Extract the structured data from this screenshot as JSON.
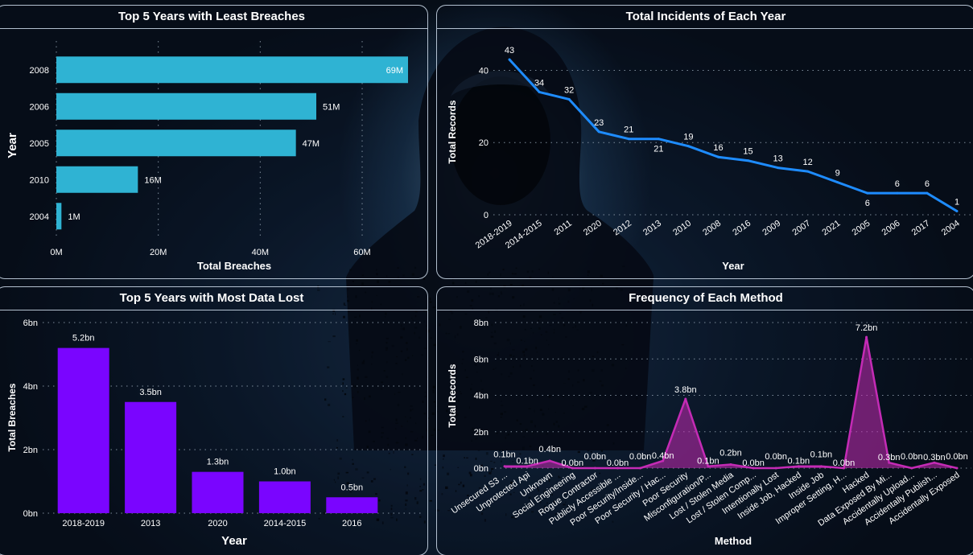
{
  "panels": {
    "least_breaches": {
      "title": "Top 5 Years with Least Breaches"
    },
    "incidents": {
      "title": "Total Incidents of Each Year"
    },
    "most_data_lost": {
      "title": "Top 5 Years with Most Data Lost"
    },
    "methods": {
      "title": "Frequency of Each Method"
    }
  },
  "colors": {
    "least_breaches_bar": "#2fb3d3",
    "incidents_line": "#1e8cff",
    "most_data_lost_bar": "#7a05ff",
    "methods_area": "#c42bb5"
  },
  "chart_data": [
    {
      "id": "least_breaches",
      "type": "bar",
      "orientation": "horizontal",
      "title": "Top 5 Years with Least Breaches",
      "xlabel": "Total Breaches",
      "ylabel": "Year",
      "categories": [
        "2008",
        "2006",
        "2005",
        "2010",
        "2004"
      ],
      "values": [
        69,
        51,
        47,
        16,
        1
      ],
      "value_labels": [
        "69M",
        "51M",
        "47M",
        "16M",
        "1M"
      ],
      "xlim": [
        0,
        69
      ],
      "x_ticks": [
        0,
        20,
        40,
        60
      ],
      "x_tick_labels": [
        "0M",
        "20M",
        "40M",
        "60M"
      ],
      "grid": true
    },
    {
      "id": "incidents",
      "type": "line",
      "title": "Total Incidents of Each Year",
      "xlabel": "Year",
      "ylabel": "Total Records",
      "categories": [
        "2018-2019",
        "2014-2015",
        "2011",
        "2020",
        "2012",
        "2013",
        "2010",
        "2008",
        "2016",
        "2009",
        "2007",
        "2021",
        "2005",
        "2006",
        "2017",
        "2004"
      ],
      "values": [
        43,
        34,
        32,
        23,
        21,
        21,
        19,
        16,
        15,
        13,
        12,
        9,
        6,
        6,
        6,
        1
      ],
      "value_labels": [
        "43",
        "34",
        "32",
        "23",
        "21",
        "21",
        "19",
        "16",
        "15",
        "13",
        "12",
        "9",
        "6",
        "6",
        "6",
        "1"
      ],
      "ylim": [
        0,
        45
      ],
      "y_ticks": [
        0,
        20,
        40
      ],
      "y_tick_labels": [
        "0",
        "20",
        "40"
      ],
      "grid": true
    },
    {
      "id": "most_data_lost",
      "type": "bar",
      "orientation": "vertical",
      "title": "Top 5 Years with Most Data Lost",
      "xlabel": "Year",
      "ylabel": "Total Breaches",
      "categories": [
        "2018-2019",
        "2013",
        "2020",
        "2014-2015",
        "2016"
      ],
      "values": [
        5.2,
        3.5,
        1.3,
        1.0,
        0.5
      ],
      "value_labels": [
        "5.2bn",
        "3.5bn",
        "1.3bn",
        "1.0bn",
        "0.5bn"
      ],
      "ylim": [
        0,
        6
      ],
      "y_ticks": [
        0,
        2,
        4,
        6
      ],
      "y_tick_labels": [
        "0bn",
        "2bn",
        "4bn",
        "6bn"
      ],
      "grid": true
    },
    {
      "id": "methods",
      "type": "area",
      "title": "Frequency of Each Method",
      "xlabel": "Method",
      "ylabel": "Total Records",
      "categories": [
        "Unsecured S3 ...",
        "Unprotected Api",
        "Unknown",
        "Social Engineering",
        "Rogue Contractor",
        "Publicly Accessible ...",
        "Poor Security/Inside...",
        "Poor Security / Hac...",
        "Poor Security",
        "Misconfiguration/P...",
        "Lost / Stolen Media",
        "Lost / Stolen Comp...",
        "Intentionally Lost",
        "Inside Job, Hacked",
        "Inside Job",
        "Improper Setting, H...",
        "Hacked",
        "Data Exposed By Mi...",
        "Accidentally Upload...",
        "Accidentally Publish...",
        "Accidentally Exposed"
      ],
      "values": [
        0.1,
        0.1,
        0.4,
        0.0,
        0.0,
        0.0,
        0.0,
        0.4,
        3.8,
        0.1,
        0.2,
        0.0,
        0.0,
        0.1,
        0.1,
        0.0,
        7.2,
        0.3,
        0.0,
        0.3,
        0.0
      ],
      "value_labels": [
        "0.1bn",
        "0.1bn",
        "0.4bn",
        "0.0bn",
        "0.0bn",
        "0.0bn",
        "0.0bn",
        "0.4bn",
        "3.8bn",
        "0.1bn",
        "0.2bn",
        "0.0bn",
        "0.0bn",
        "0.1bn",
        "0.1bn",
        "0.0bn",
        "7.2bn",
        "0.3bn",
        "0.0bn",
        "0.3bn",
        "0.0bn"
      ],
      "ylim": [
        0,
        8
      ],
      "y_ticks": [
        0,
        2,
        4,
        6,
        8
      ],
      "y_tick_labels": [
        "0bn",
        "2bn",
        "4bn",
        "6bn",
        "8bn"
      ],
      "grid": true
    }
  ]
}
